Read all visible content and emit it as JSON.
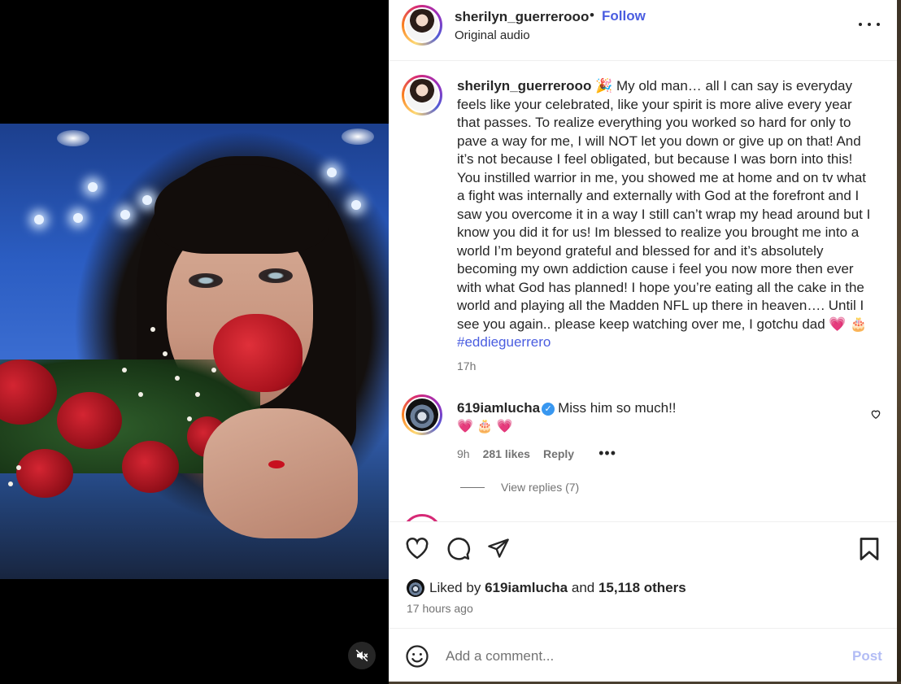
{
  "post": {
    "username": "sherilyn_guerrerooo",
    "separator": "•",
    "follow_label": "Follow",
    "audio_label": "Original audio"
  },
  "caption": {
    "username": "sherilyn_guerrerooo",
    "text": " 🎉 My old man… all I can say is everyday feels like your celebrated, like your spirit is more alive every year that passes. To realize everything you worked so hard for only to pave a way for me, I will NOT let you down or give up on that! And it’s not because I feel obligated, but because I was born into this! You instilled warrior in me, you showed me at home and on tv what a fight was internally and externally with God at the forefront and I saw you overcome it in a way I still can’t wrap my head around but I know you did it for us! Im blessed to realize you brought me into a world I’m beyond grateful and blessed for and it’s absolutely becoming my own addiction cause i feel you now more then ever with what God has planned! I hope you’re eating all the cake in the world and playing all the Madden NFL up there in heaven…. Until I see you again.. please keep watching over me, I gotchu dad 💗 🎂 ",
    "hashtag": "#eddieguerrero",
    "time": "17h"
  },
  "comment": {
    "username": "619iamlucha",
    "verified_glyph": "✓",
    "text": "Miss him so much!!",
    "emojis": "💗 🎂 💗",
    "time": "9h",
    "likes": "281 likes",
    "reply_label": "Reply",
    "more_glyph": "•••",
    "view_replies": "View replies (7)"
  },
  "likes": {
    "prefix": "Liked by ",
    "user": "619iamlucha",
    "middle": " and ",
    "others": "15,118 others",
    "time": "17 hours ago"
  },
  "comment_box": {
    "placeholder": "Add a comment...",
    "post_label": "Post"
  },
  "icons": {
    "mute": "speaker-muted-icon",
    "like": "heart-icon",
    "comment": "comment-bubble-icon",
    "share": "paper-plane-icon",
    "save": "bookmark-icon",
    "emoji": "smiley-icon",
    "more": "ellipsis-icon"
  },
  "colors": {
    "link_blue": "#4a5de0",
    "post_disabled": "#b2bcf5",
    "muted_text": "#737373",
    "verified": "#3897f0"
  }
}
